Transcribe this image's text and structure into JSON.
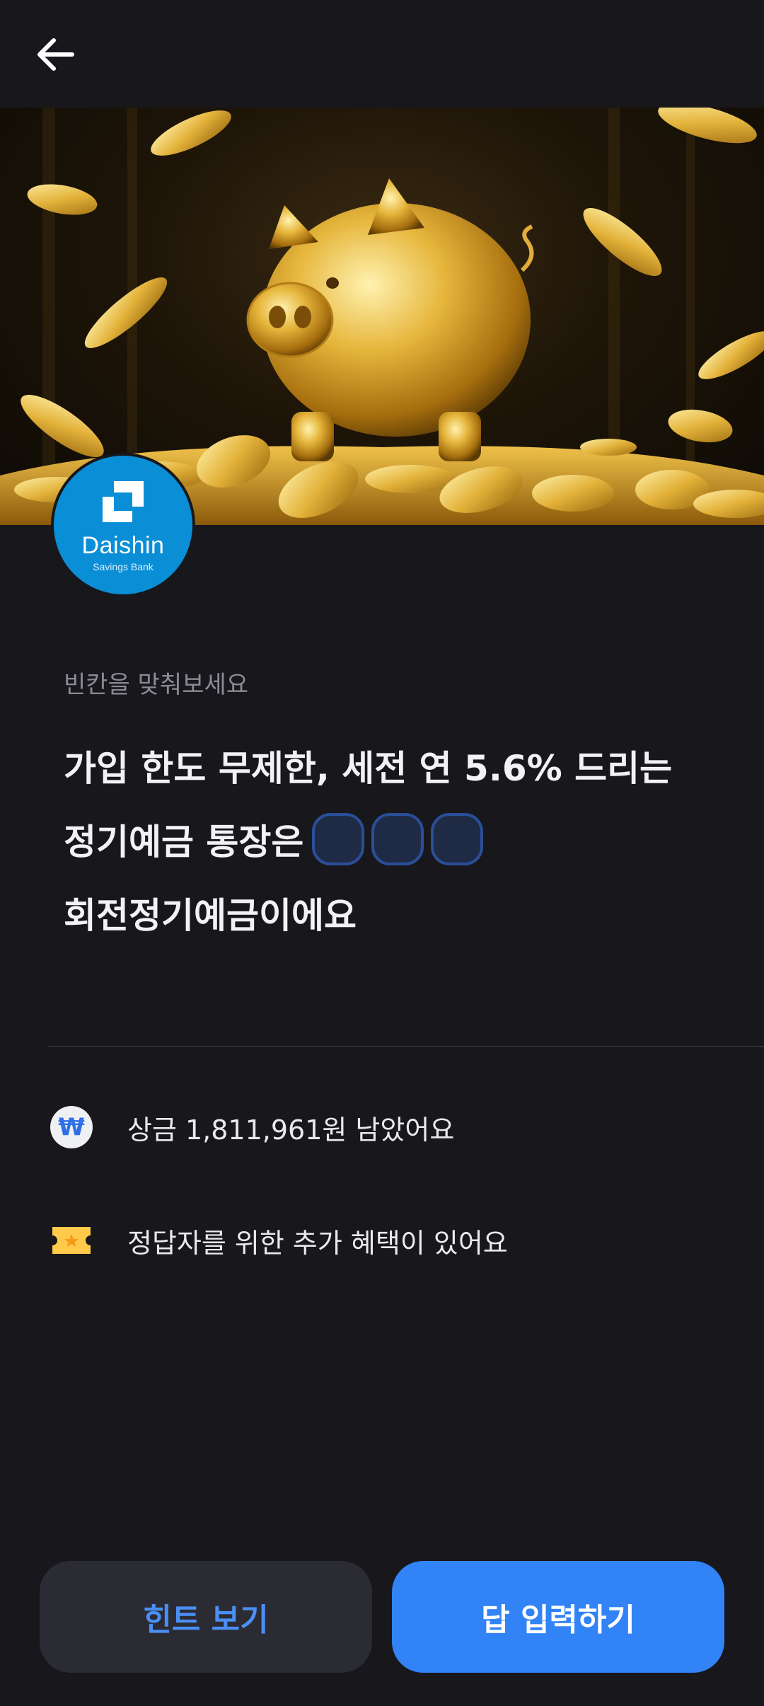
{
  "header": {
    "back_icon": "arrow-left-icon"
  },
  "hero": {
    "image": "golden-piggy-bank-with-coins"
  },
  "brand": {
    "name": "Daishin",
    "sub": "Savings Bank",
    "color": "#0a8fd6"
  },
  "quiz": {
    "instruction": "빈칸을 맞춰보세요",
    "line1": "가입 한도 무제한, 세전 연 5.6% 드리는",
    "line2": "정기예금 통장은",
    "line3": "회전정기예금이에요",
    "blank_count": 3
  },
  "info": {
    "prize_icon": "won-coin-icon",
    "prize_text": "상금 1,811,961원 남았어요",
    "benefit_icon": "ticket-icon",
    "benefit_text": "정답자를 위한 추가 혜택이 있어요"
  },
  "actions": {
    "hint_label": "힌트 보기",
    "answer_label": "답 입력하기"
  },
  "colors": {
    "background": "#17171c",
    "accent": "#3183f6",
    "blank_fill": "#1f2a44",
    "blank_border": "#2a4f99",
    "ticket": "#ffc94a"
  }
}
